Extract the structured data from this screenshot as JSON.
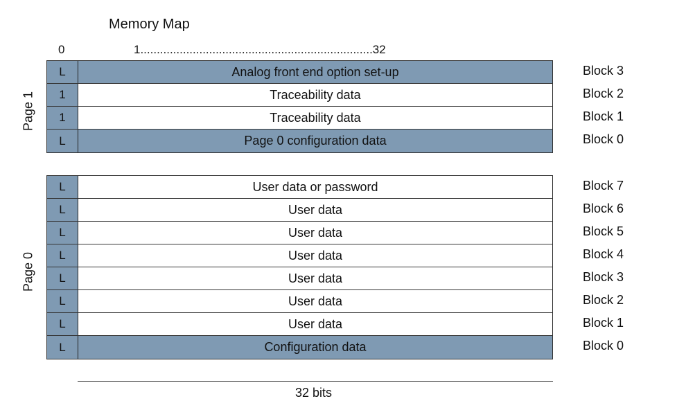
{
  "title": "Memory Map",
  "bit_header": {
    "start": "0",
    "range": "1.......................................................................32"
  },
  "pages": [
    {
      "label": "Page 1",
      "rows": [
        {
          "lock": "L",
          "text": "Analog front end option set-up",
          "block": "Block 3",
          "shaded": true
        },
        {
          "lock": "1",
          "text": "Traceability data",
          "block": "Block 2",
          "shaded": false
        },
        {
          "lock": "1",
          "text": "Traceability data",
          "block": "Block 1",
          "shaded": false
        },
        {
          "lock": "L",
          "text": "Page 0 configuration data",
          "block": "Block 0",
          "shaded": true
        }
      ]
    },
    {
      "label": "Page 0",
      "rows": [
        {
          "lock": "L",
          "text": "User data or password",
          "block": "Block 7",
          "shaded": false
        },
        {
          "lock": "L",
          "text": "User data",
          "block": "Block 6",
          "shaded": false
        },
        {
          "lock": "L",
          "text": "User data",
          "block": "Block 5",
          "shaded": false
        },
        {
          "lock": "L",
          "text": "User data",
          "block": "Block 4",
          "shaded": false
        },
        {
          "lock": "L",
          "text": "User data",
          "block": "Block 3",
          "shaded": false
        },
        {
          "lock": "L",
          "text": "User data",
          "block": "Block 2",
          "shaded": false
        },
        {
          "lock": "L",
          "text": "User data",
          "block": "Block 1",
          "shaded": false
        },
        {
          "lock": "L",
          "text": "Configuration data",
          "block": "Block 0",
          "shaded": true
        }
      ]
    }
  ],
  "width_label": "32 bits",
  "colors": {
    "shaded": "#7f9ab3",
    "border": "#333333"
  }
}
